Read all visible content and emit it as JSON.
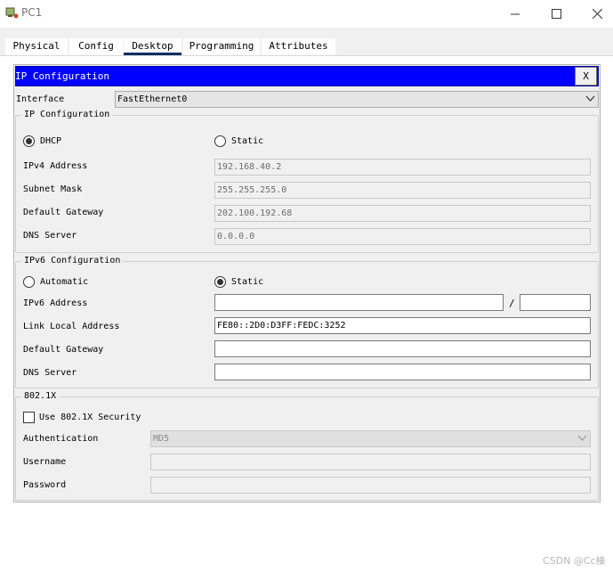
{
  "window": {
    "title": "PC1"
  },
  "tabs": [
    {
      "label": "Physical"
    },
    {
      "label": "Config"
    },
    {
      "label": "Desktop"
    },
    {
      "label": "Programming"
    },
    {
      "label": "Attributes"
    }
  ],
  "dialog": {
    "title": "IP Configuration",
    "close_label": "X"
  },
  "interface": {
    "label": "Interface",
    "value": "FastEthernet0"
  },
  "ipv4": {
    "group_title": "IP Configuration",
    "dhcp_label": "DHCP",
    "static_label": "Static",
    "selected_mode": "DHCP",
    "address_label": "IPv4 Address",
    "address_value": "192.168.40.2",
    "mask_label": "Subnet Mask",
    "mask_value": "255.255.255.0",
    "gateway_label": "Default Gateway",
    "gateway_value": "202.100.192.68",
    "dns_label": "DNS Server",
    "dns_value": "0.0.0.0"
  },
  "ipv6": {
    "group_title": "IPv6 Configuration",
    "automatic_label": "Automatic",
    "static_label": "Static",
    "selected_mode": "Static",
    "address_label": "IPv6 Address",
    "address_value": "",
    "prefix_separator": "/",
    "prefix_value": "",
    "link_local_label": "Link Local Address",
    "link_local_value": "FE80::2D0:D3FF:FEDC:3252",
    "gateway_label": "Default Gateway",
    "gateway_value": "",
    "dns_label": "DNS Server",
    "dns_value": ""
  },
  "dot1x": {
    "group_title": "802.1X",
    "use_security_label": "Use 802.1X Security",
    "use_security_checked": false,
    "auth_label": "Authentication",
    "auth_value": "MD5",
    "username_label": "Username",
    "username_value": "",
    "password_label": "Password",
    "password_value": ""
  },
  "watermark": "CSDN @Cc榛",
  "colors": {
    "dialog_header": "#0000ff",
    "active_tab_underline": "#0d2e62"
  }
}
